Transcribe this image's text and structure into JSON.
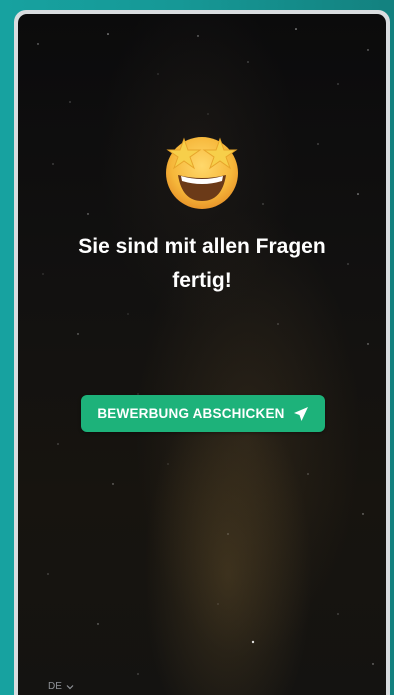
{
  "completion": {
    "headline": "Sie sind mit allen Fragen fertig!",
    "emoji_icon": "star-struck-emoji"
  },
  "actions": {
    "submit_label": "BEWERBUNG ABSCHICKEN",
    "submit_icon": "send-icon",
    "submit_color": "#1db27a"
  },
  "footer": {
    "language": "DE",
    "language_icon": "chevron-down-icon"
  }
}
